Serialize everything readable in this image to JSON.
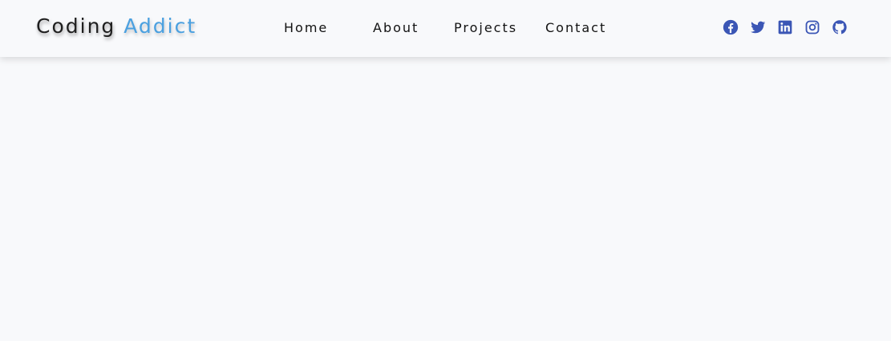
{
  "logo": {
    "first": "Coding",
    "second": "Addict",
    "first_color": "#1f1f1f",
    "second_color": "#4aa0e0"
  },
  "nav": {
    "home": "Home",
    "about": "About",
    "projects": "Projects",
    "contact": "Contact"
  },
  "socials": [
    {
      "icon": "facebook-icon"
    },
    {
      "icon": "twitter-icon"
    },
    {
      "icon": "linkedin-icon"
    },
    {
      "icon": "instagram-icon"
    },
    {
      "icon": "github-icon"
    }
  ],
  "colors": {
    "background": "#f8f9fb",
    "nav_text": "#121212",
    "social_icon": "#3b56b5"
  }
}
